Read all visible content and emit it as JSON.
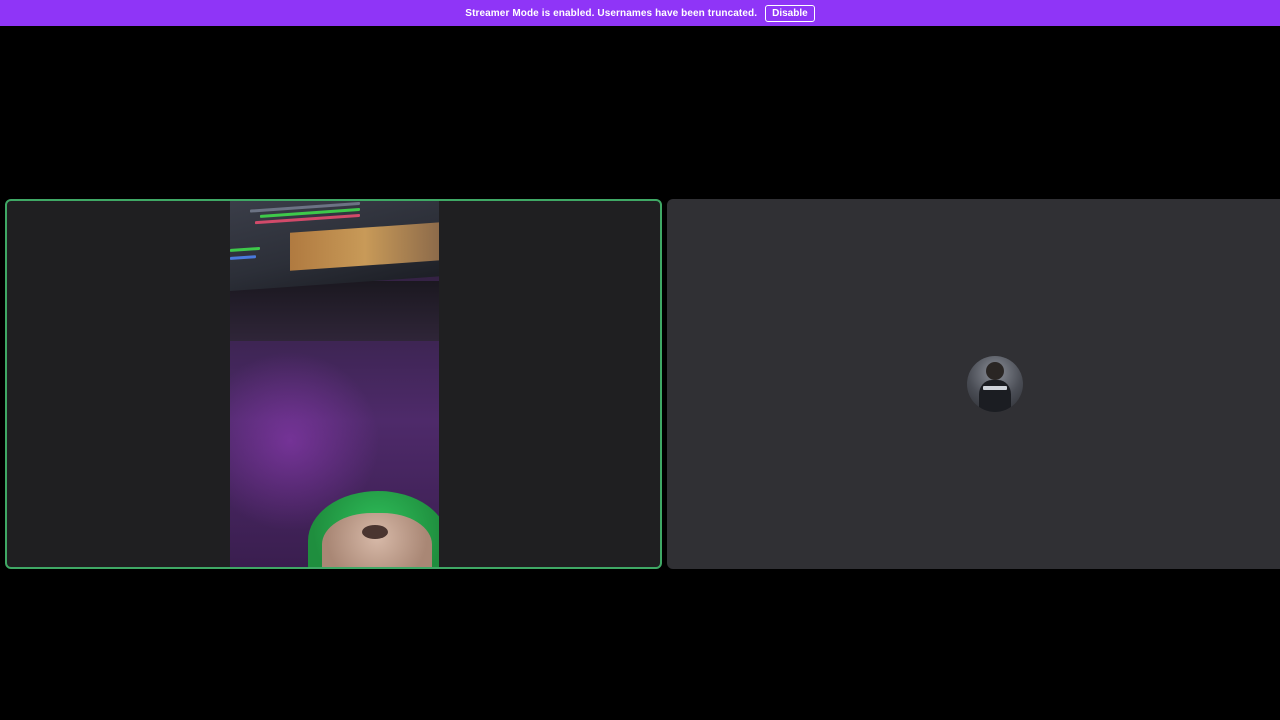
{
  "notice": {
    "message": "Streamer Mode is enabled. Usernames have been truncated.",
    "button_label": "Disable"
  },
  "colors": {
    "notice_bg": "#8f35f7",
    "speaking_border": "#3fa865",
    "tile_left_bg": "#1f1f21",
    "tile_right_bg": "#303034",
    "app_bg": "#000000"
  },
  "tiles": [
    {
      "type": "video",
      "speaking": true
    },
    {
      "type": "avatar",
      "speaking": false
    }
  ]
}
